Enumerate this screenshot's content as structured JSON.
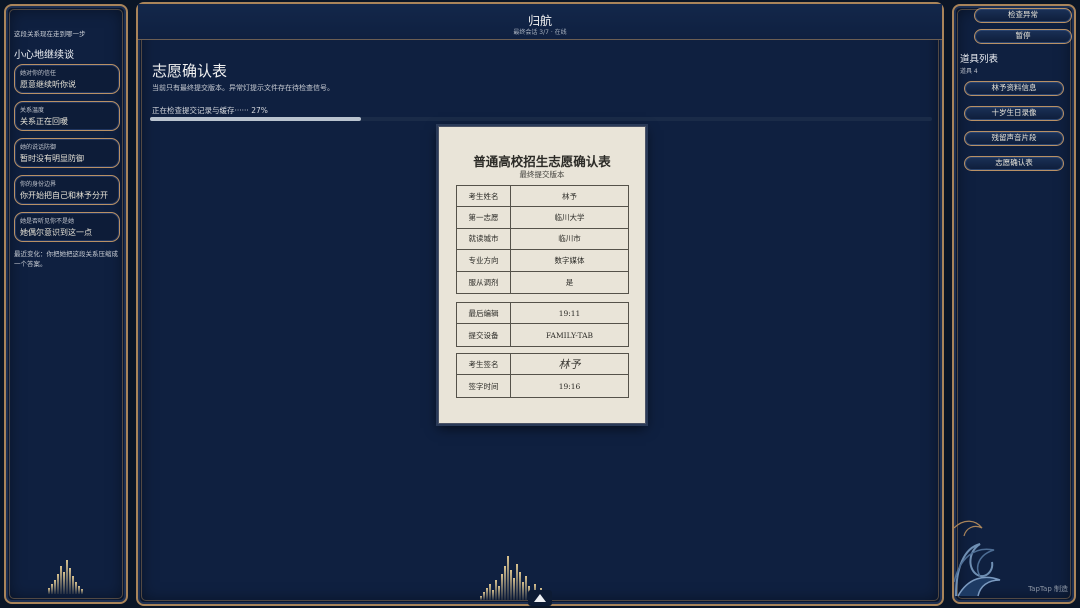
{
  "left_panel": {
    "intro": "这段关系现在走到哪一步",
    "title": "小心地继续谈",
    "status_items": [
      {
        "label": "她对你的信任",
        "value": "愿意继续听你说"
      },
      {
        "label": "关系温度",
        "value": "关系正在回暖"
      },
      {
        "label": "她的说话防御",
        "value": "暂时没有明显防御"
      },
      {
        "label": "你的身份边界",
        "value": "你开始把自己和林予分开"
      },
      {
        "label": "她是否听见你不是她",
        "value": "她偶尔意识到这一点"
      }
    ],
    "footer": "最近变化：你把她把这段关系压缩成一个答案。"
  },
  "header": {
    "title": "归航",
    "subtitle": "最终会话 3/7 · 在线"
  },
  "main": {
    "page_title": "志愿确认表",
    "description": "当前只有最终提交版本。异常灯提示文件存在待检查信号。",
    "progress_label": "正在检查提交记录与缓存······ 27%",
    "progress_value": 0.27
  },
  "document": {
    "title": "普通高校招生志愿确认表",
    "subtitle": "最终提交版本",
    "section1": [
      {
        "key": "考生姓名",
        "value": "林予"
      },
      {
        "key": "第一志愿",
        "value": "临川大学"
      },
      {
        "key": "就读城市",
        "value": "临川市"
      },
      {
        "key": "专业方向",
        "value": "数字媒体"
      },
      {
        "key": "服从调剂",
        "value": "是"
      }
    ],
    "section2": [
      {
        "key": "最后编辑",
        "value": "19:11"
      },
      {
        "key": "提交设备",
        "value": "FAMILY-TAB"
      }
    ],
    "section3": [
      {
        "key": "考生签名",
        "value": "林予"
      },
      {
        "key": "签字时间",
        "value": "19:16"
      }
    ]
  },
  "right_panel": {
    "check_button": "检查异常",
    "pause_button": "暂停",
    "list_title": "道具列表",
    "list_count": "道具 4",
    "items": [
      "林予资料信息",
      "十岁生日录像",
      "残留声音片段",
      "志愿确认表"
    ]
  },
  "watermark": "TapTap 制造",
  "colors": {
    "background": "#0a1526",
    "panel": "#0f2040",
    "gold_border": "#a9845a",
    "paper": "#e9e4d8",
    "progress_fill": "#b9c3cf"
  }
}
